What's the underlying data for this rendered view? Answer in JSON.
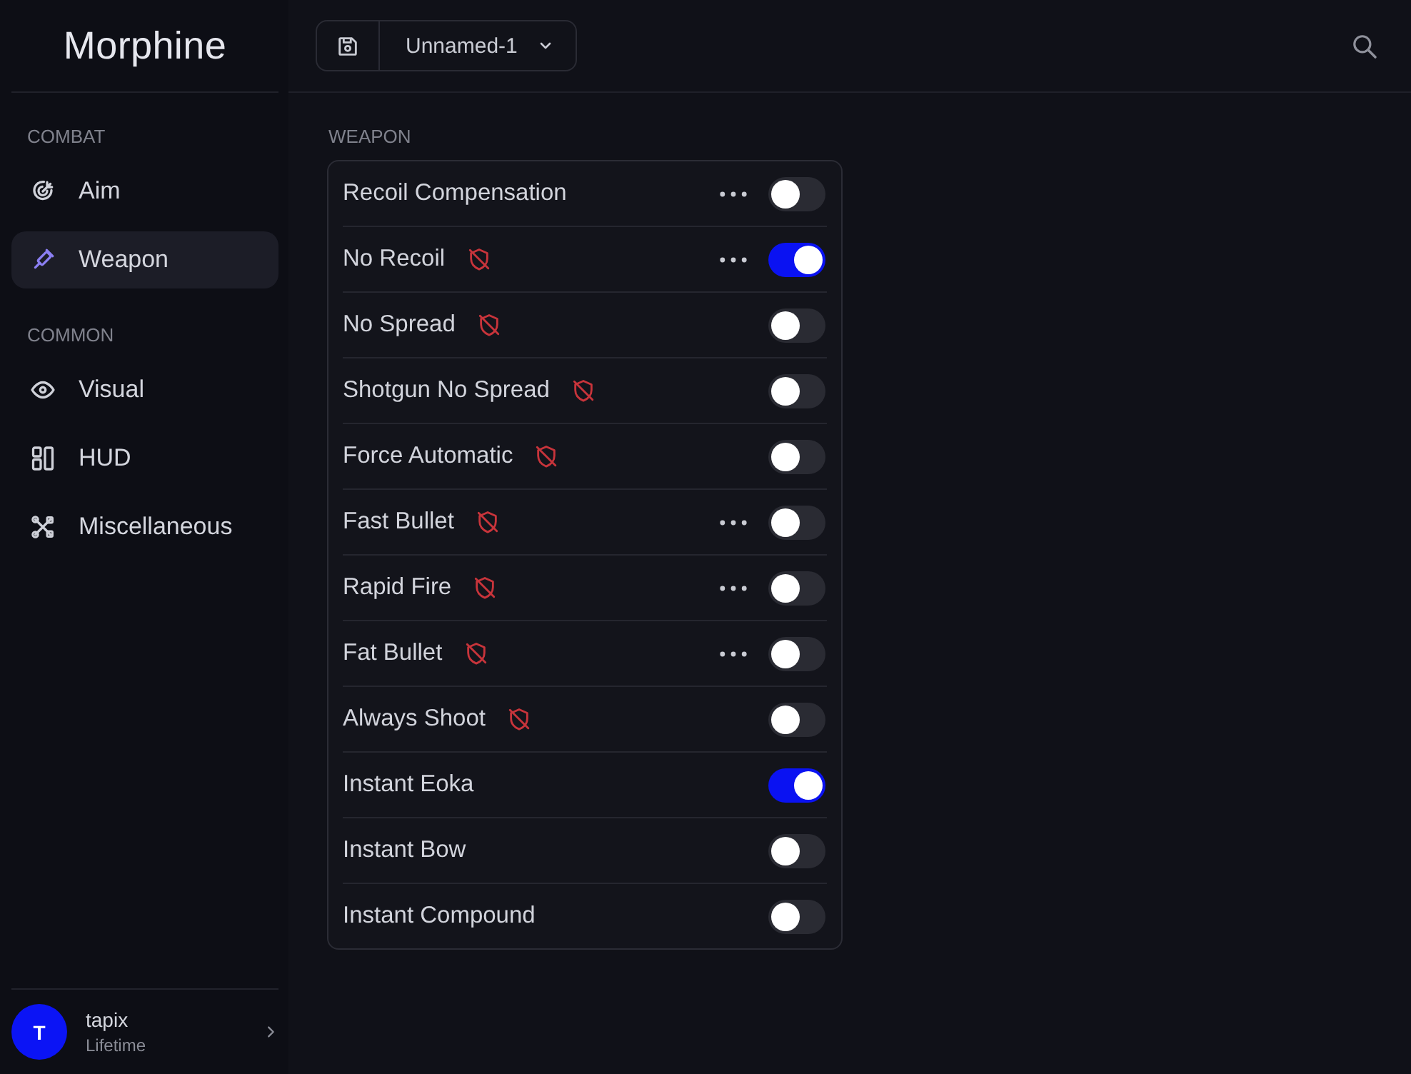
{
  "app": {
    "title": "Morphine"
  },
  "sidebar": {
    "sections": [
      {
        "label": "COMBAT",
        "items": [
          {
            "label": "Aim",
            "kind": "aim",
            "selected": false
          },
          {
            "label": "Weapon",
            "kind": "weapon",
            "selected": true
          }
        ]
      },
      {
        "label": "COMMON",
        "items": [
          {
            "label": "Visual",
            "kind": "visual",
            "selected": false
          },
          {
            "label": "HUD",
            "kind": "hud",
            "selected": false
          },
          {
            "label": "Miscellaneous",
            "kind": "misc",
            "selected": false
          }
        ]
      }
    ]
  },
  "user": {
    "initial": "T",
    "name": "tapix",
    "plan": "Lifetime"
  },
  "toolbar": {
    "config": "Unnamed-1"
  },
  "section": {
    "title": "WEAPON",
    "options": [
      {
        "label": "Recoil Compensation",
        "risky": false,
        "has_settings": true,
        "on": false
      },
      {
        "label": "No Recoil",
        "risky": true,
        "has_settings": true,
        "on": true
      },
      {
        "label": "No Spread",
        "risky": true,
        "has_settings": false,
        "on": false
      },
      {
        "label": "Shotgun No Spread",
        "risky": true,
        "has_settings": false,
        "on": false
      },
      {
        "label": "Force Automatic",
        "risky": true,
        "has_settings": false,
        "on": false
      },
      {
        "label": "Fast Bullet",
        "risky": true,
        "has_settings": true,
        "on": false
      },
      {
        "label": "Rapid Fire",
        "risky": true,
        "has_settings": true,
        "on": false
      },
      {
        "label": "Fat Bullet",
        "risky": true,
        "has_settings": true,
        "on": false
      },
      {
        "label": "Always Shoot",
        "risky": true,
        "has_settings": false,
        "on": false
      },
      {
        "label": "Instant Eoka",
        "risky": false,
        "has_settings": false,
        "on": true
      },
      {
        "label": "Instant Bow",
        "risky": false,
        "has_settings": false,
        "on": false
      },
      {
        "label": "Instant Compound",
        "risky": false,
        "has_settings": false,
        "on": false
      }
    ]
  }
}
